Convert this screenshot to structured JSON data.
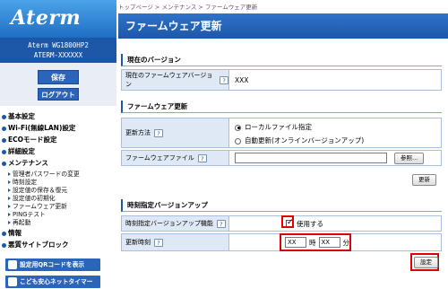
{
  "sidebar": {
    "logo": "Aterm",
    "model_line1": "Aterm WG1800HP2",
    "model_line2": "ATERM-XXXXXX",
    "save_label": "保存",
    "logout_label": "ログアウト",
    "nav": [
      {
        "label": "基本設定"
      },
      {
        "label": "Wi-Fi(無線LAN)設定"
      },
      {
        "label": "ECOモード設定"
      },
      {
        "label": "詳細設定"
      },
      {
        "label": "メンテナンス"
      }
    ],
    "maintenance_sub": [
      {
        "label": "管理者パスワードの変更"
      },
      {
        "label": "時刻設定"
      },
      {
        "label": "設定値の保存＆復元"
      },
      {
        "label": "設定値の初期化"
      },
      {
        "label": "ファームウェア更新"
      },
      {
        "label": "PINGテスト"
      },
      {
        "label": "再起動"
      }
    ],
    "nav2": [
      {
        "label": "情報"
      },
      {
        "label": "悪質サイトブロック"
      }
    ],
    "qr_button": "設定用QRコードを表示",
    "timer_button": "こども安心ネットタイマー"
  },
  "main": {
    "breadcrumb": "トップページ > メンテナンス > ファームウェア更新",
    "title": "ファームウェア更新",
    "current_section": "現在のバージョン",
    "current_version_label": "現在のファームウェアバージョン",
    "current_version_value": "XXX",
    "update_section": "ファームウェア更新",
    "update_method_label": "更新方法",
    "method_local": "ローカルファイル指定",
    "method_auto": "自動更新(オンラインバージョンアップ)",
    "firmware_file_label": "ファームウェアファイル",
    "browse_label": "参照...",
    "update_button": "更新",
    "scheduled_section": "時刻指定バージョンアップ",
    "scheduled_func_label": "時刻指定バージョンアップ機能",
    "use_label": "使用する",
    "update_time_label": "更新時刻",
    "hour_value": "XX",
    "hour_unit": "時",
    "minute_value": "XX",
    "minute_unit": "分",
    "set_button": "設定",
    "help_glyph": "?"
  },
  "colors": {
    "brand_blue": "#1d58a8",
    "highlight_red": "#e00000"
  }
}
